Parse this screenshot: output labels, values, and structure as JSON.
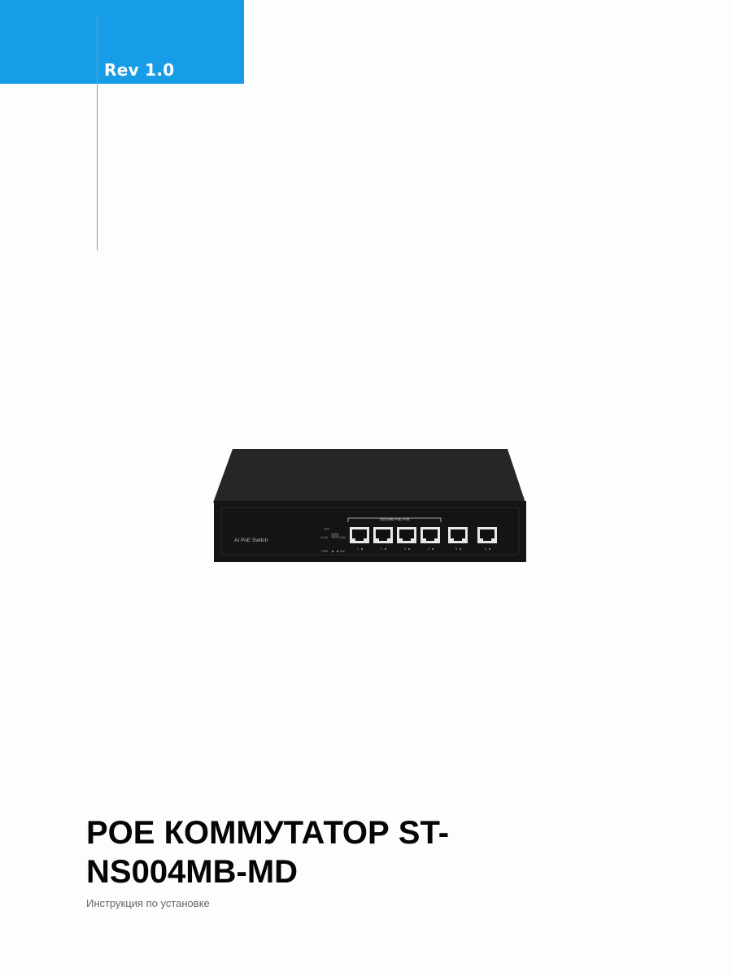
{
  "cover": {
    "revision": "Rev 1.0",
    "title_line1": "POE КОММУТАТОР ST-",
    "title_line2": "NS004MB-MD",
    "subtitle": "Инструкция по установке"
  },
  "device": {
    "brand_label": "AI PoE Switch",
    "port_group_label": "10/100M PoE Port",
    "port_numbers": [
      "1",
      "2",
      "3",
      "4",
      "5",
      "6"
    ],
    "switch_labels": [
      "OFF",
      "VLAN",
      "CAM"
    ],
    "led_labels": [
      "PWR",
      "SW"
    ]
  },
  "colors": {
    "accent_blue": "#179de8",
    "device_body": "#1c1c1c",
    "device_panel": "#0d0d0d"
  }
}
